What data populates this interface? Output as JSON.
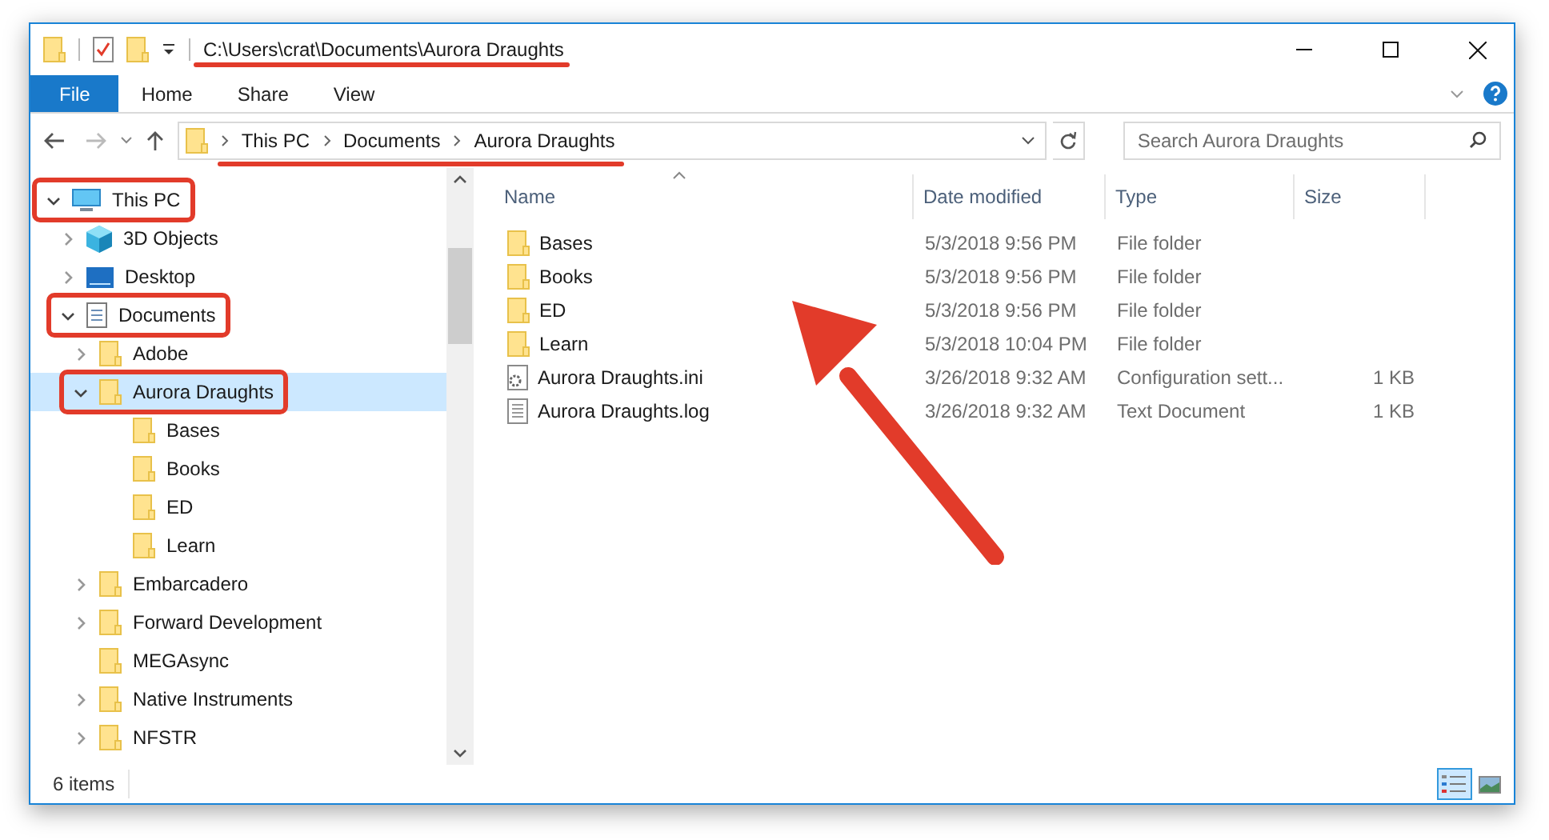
{
  "window": {
    "title": "C:\\Users\\crat\\Documents\\Aurora Draughts",
    "title_underlined": true
  },
  "ribbon": {
    "tabs": [
      {
        "label": "File",
        "selected": true
      },
      {
        "label": "Home",
        "selected": false
      },
      {
        "label": "Share",
        "selected": false
      },
      {
        "label": "View",
        "selected": false
      }
    ]
  },
  "address_bar": {
    "breadcrumbs": [
      "This PC",
      "Documents",
      "Aurora Draughts"
    ],
    "underlined": true
  },
  "search": {
    "placeholder": "Search Aurora Draughts"
  },
  "navigation": {
    "items": [
      {
        "label": "This PC",
        "kind": "pc",
        "expandable": true,
        "expanded": true,
        "selected": false,
        "annotated": true,
        "children": [
          {
            "label": "3D Objects",
            "kind": "cube",
            "expandable": true,
            "expanded": false,
            "selected": false,
            "annotated": false
          },
          {
            "label": "Desktop",
            "kind": "desktop",
            "expandable": true,
            "expanded": false,
            "selected": false,
            "annotated": false
          },
          {
            "label": "Documents",
            "kind": "document",
            "expandable": true,
            "expanded": true,
            "selected": false,
            "annotated": true,
            "children": [
              {
                "label": "Adobe",
                "kind": "folder",
                "expandable": true,
                "expanded": false,
                "selected": false,
                "annotated": false
              },
              {
                "label": "Aurora Draughts",
                "kind": "folder",
                "expandable": true,
                "expanded": true,
                "selected": true,
                "annotated": true,
                "children": [
                  {
                    "label": "Bases",
                    "kind": "folder",
                    "expandable": false,
                    "expanded": false,
                    "selected": false,
                    "annotated": false
                  },
                  {
                    "label": "Books",
                    "kind": "folder",
                    "expandable": false,
                    "expanded": false,
                    "selected": false,
                    "annotated": false
                  },
                  {
                    "label": "ED",
                    "kind": "folder",
                    "expandable": false,
                    "expanded": false,
                    "selected": false,
                    "annotated": false
                  },
                  {
                    "label": "Learn",
                    "kind": "folder",
                    "expandable": false,
                    "expanded": false,
                    "selected": false,
                    "annotated": false
                  }
                ]
              },
              {
                "label": "Embarcadero",
                "kind": "folder",
                "expandable": true,
                "expanded": false,
                "selected": false,
                "annotated": false
              },
              {
                "label": "Forward Development",
                "kind": "folder",
                "expandable": true,
                "expanded": false,
                "selected": false,
                "annotated": false
              },
              {
                "label": "MEGAsync",
                "kind": "folder",
                "expandable": false,
                "expanded": false,
                "selected": false,
                "annotated": false
              },
              {
                "label": "Native Instruments",
                "kind": "folder",
                "expandable": true,
                "expanded": false,
                "selected": false,
                "annotated": false
              },
              {
                "label": "NFSTR",
                "kind": "folder",
                "expandable": true,
                "expanded": false,
                "selected": false,
                "annotated": false
              }
            ]
          }
        ]
      }
    ]
  },
  "table": {
    "columns": [
      "Name",
      "Date modified",
      "Type",
      "Size"
    ],
    "rows": [
      {
        "kind": "folder",
        "name": "Bases",
        "date": "5/3/2018 9:56 PM",
        "type": "File folder"
      },
      {
        "kind": "folder",
        "name": "Books",
        "date": "5/3/2018 9:56 PM",
        "type": "File folder"
      },
      {
        "kind": "folder",
        "name": "ED",
        "date": "5/3/2018 9:56 PM",
        "type": "File folder"
      },
      {
        "kind": "folder",
        "name": "Learn",
        "date": "5/3/2018 10:04 PM",
        "type": "File folder"
      },
      {
        "kind": "settings",
        "name": "Aurora Draughts.ini",
        "date": "3/26/2018 9:32 AM",
        "type": "Configuration sett...",
        "size": "1 KB"
      },
      {
        "kind": "text",
        "name": "Aurora Draughts.log",
        "date": "3/26/2018 9:32 AM",
        "type": "Text Document",
        "size": "1 KB"
      }
    ]
  },
  "status_bar": {
    "text": "6 items",
    "views": [
      {
        "kind": "details",
        "selected": true
      },
      {
        "kind": "thumbnails",
        "selected": false
      }
    ]
  }
}
